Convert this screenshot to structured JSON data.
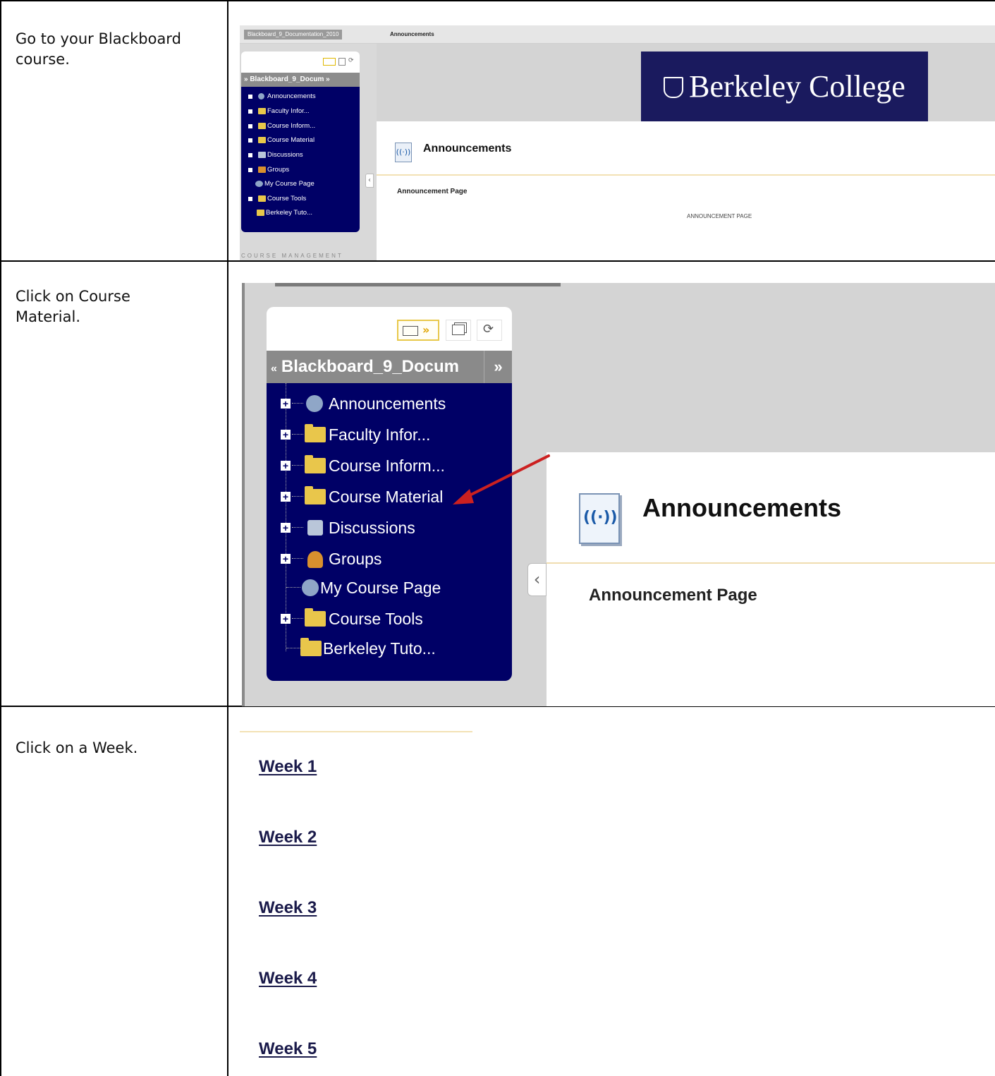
{
  "steps": [
    {
      "instruction": " Go to your Blackboard course."
    },
    {
      "instruction": "Click on Course Material."
    },
    {
      "instruction": "Click on a Week."
    }
  ],
  "shot1": {
    "breadcrumb_course": "Blackboard_9_Documentation_2010",
    "breadcrumb_page": "Announcements",
    "menu_title": "» Blackboard_9_Docum »",
    "menu_items": [
      "Announcements",
      "Faculty Infor...",
      "Course Inform...",
      "Course Material",
      "Discussions",
      "Groups",
      "My Course Page",
      "Course Tools",
      "Berkeley Tuto..."
    ],
    "management_label": "COURSE MANAGEMENT",
    "banner_text": "Berkeley College",
    "content_title": "Announcements",
    "content_subtitle": "Announcement Page",
    "content_caps": "ANNOUNCEMENT PAGE"
  },
  "shot2": {
    "menu_title": "Blackboard_9_Docum",
    "menu_items": [
      {
        "label": "Announcements",
        "icon": "announcements-icon",
        "expand": true
      },
      {
        "label": "Faculty Infor...",
        "icon": "folder-icon",
        "expand": true
      },
      {
        "label": "Course Inform...",
        "icon": "folder-icon",
        "expand": true
      },
      {
        "label": "Course Material",
        "icon": "folder-icon",
        "expand": true
      },
      {
        "label": "Discussions",
        "icon": "discussions-icon",
        "expand": true
      },
      {
        "label": "Groups",
        "icon": "groups-icon",
        "expand": true
      },
      {
        "label": "My Course Page",
        "icon": "globe-icon",
        "expand": false
      },
      {
        "label": "Course Tools",
        "icon": "folder-icon",
        "expand": true
      },
      {
        "label": "Berkeley Tuto...",
        "icon": "folder-icon",
        "expand": false
      }
    ],
    "content_title": "Announcements",
    "content_subtitle": "Announcement Page",
    "arrow_color": "#cc2020"
  },
  "shot3": {
    "weeks": [
      "Week 1",
      "Week 2",
      "Week 3",
      "Week 4",
      "Week 5"
    ]
  },
  "colors": {
    "menu_bg": "#000066",
    "menu_header": "#8a8a8a",
    "banner_bg": "#1a1a5e",
    "accent_line": "#f3e2b5"
  }
}
